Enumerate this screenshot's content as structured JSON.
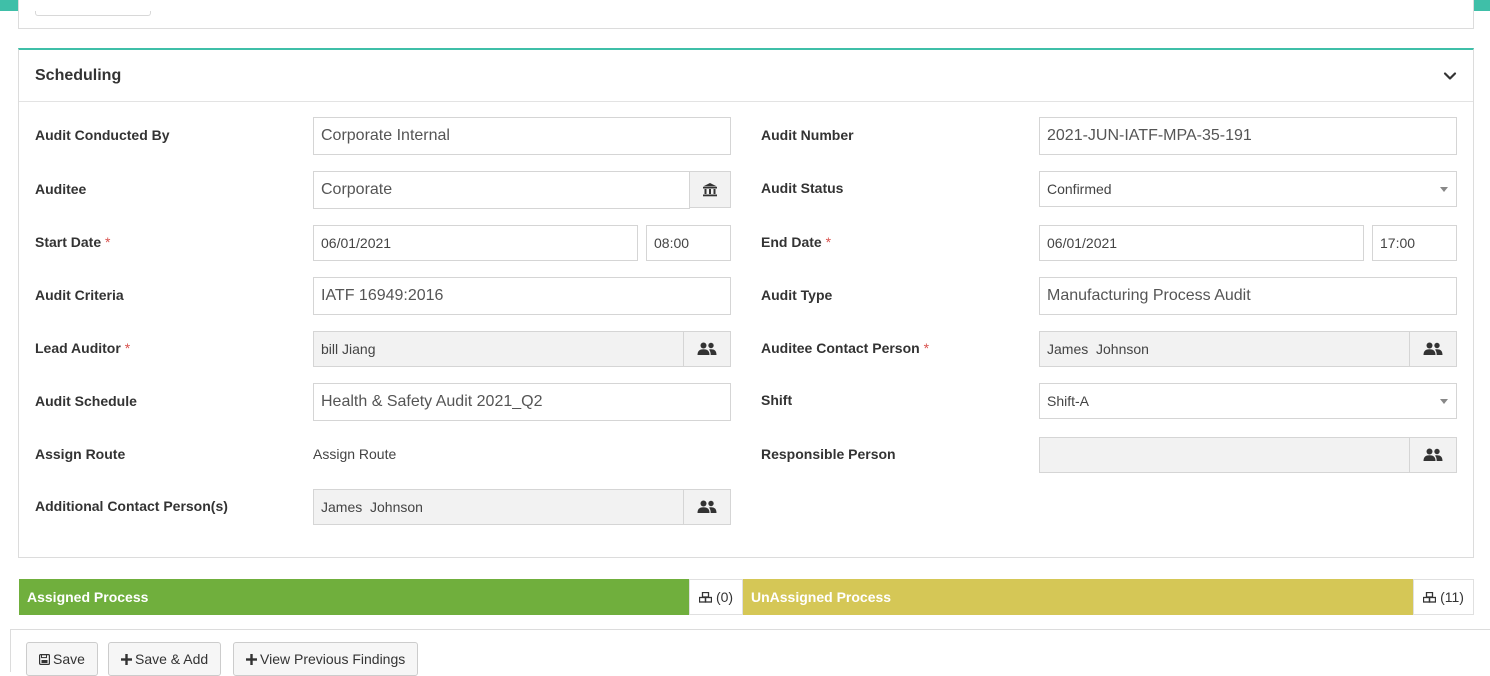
{
  "section": {
    "title": "Scheduling"
  },
  "fields": {
    "audit_conducted_by": {
      "label": "Audit Conducted By",
      "value": "Corporate Internal"
    },
    "audit_number": {
      "label": "Audit Number",
      "value": "2021-JUN-IATF-MPA-35-191"
    },
    "auditee": {
      "label": "Auditee",
      "value": "Corporate",
      "icon": "institution-icon"
    },
    "audit_status": {
      "label": "Audit Status",
      "value": "Confirmed"
    },
    "start_date": {
      "label": "Start Date",
      "required": "*",
      "date": "06/01/2021",
      "time": "08:00"
    },
    "end_date": {
      "label": "End Date",
      "required": "*",
      "date": "06/01/2021",
      "time": "17:00"
    },
    "audit_criteria": {
      "label": "Audit Criteria",
      "value": "IATF 16949:2016"
    },
    "audit_type": {
      "label": "Audit Type",
      "value": "Manufacturing Process Audit"
    },
    "lead_auditor": {
      "label": "Lead Auditor",
      "required": "*",
      "value": "bill Jiang",
      "icon": "users-icon"
    },
    "auditee_contact": {
      "label": "Auditee Contact Person",
      "required": "*",
      "value": "James  Johnson",
      "icon": "users-icon"
    },
    "audit_schedule": {
      "label": "Audit Schedule",
      "value": "Health & Safety Audit 2021_Q2"
    },
    "shift": {
      "label": "Shift",
      "value": "Shift-A"
    },
    "assign_route": {
      "label": "Assign Route",
      "value": "Assign Route"
    },
    "responsible_person": {
      "label": "Responsible Person",
      "value": "",
      "icon": "users-icon"
    },
    "additional_contact": {
      "label": "Additional Contact Person(s)",
      "value": "James  Johnson",
      "icon": "users-icon"
    }
  },
  "process_bars": {
    "assigned": {
      "label": "Assigned Process",
      "count": "(0)"
    },
    "unassigned": {
      "label": "UnAssigned Process",
      "count": "(11)"
    }
  },
  "footer": {
    "save": "Save",
    "save_add": "Save & Add",
    "view_findings": "View Previous Findings"
  },
  "colors": {
    "accent": "#3fbfa8",
    "assigned": "#70af3d",
    "unassigned": "#d5c756",
    "required": "#d9534f"
  }
}
